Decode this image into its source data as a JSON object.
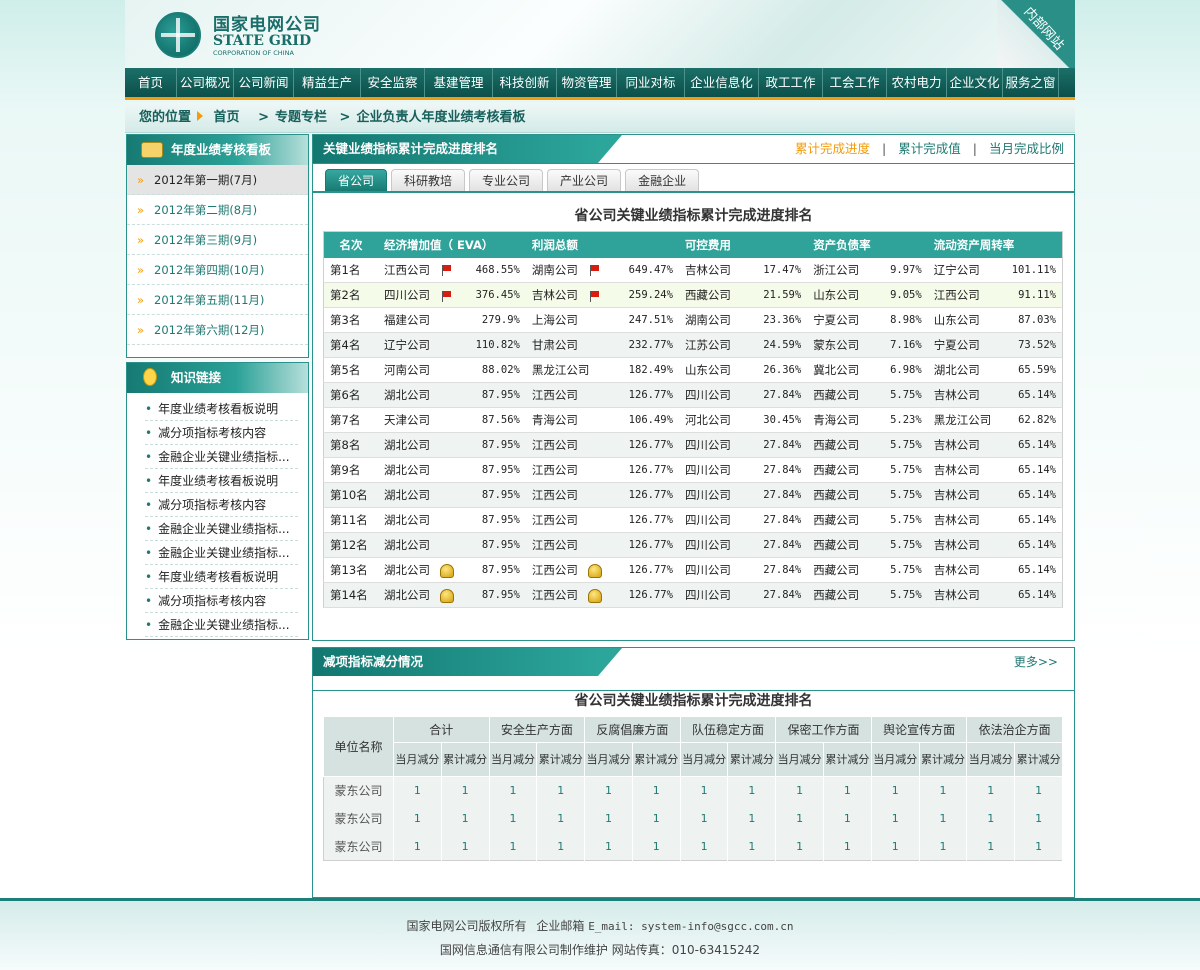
{
  "header": {
    "logo_cn": "国家电网公司",
    "logo_en": "STATE GRID",
    "logo_sub": "CORPORATION OF CHINA",
    "corner_badge": "内部网站"
  },
  "nav": [
    "首页",
    "公司概况",
    "公司新闻",
    "精益生产",
    "安全监察",
    "基建管理",
    "科技创新",
    "物资管理",
    "同业对标",
    "企业信息化",
    "政工工作",
    "工会工作",
    "农村电力",
    "企业文化",
    "服务之窗"
  ],
  "breadcrumb": {
    "label": "您的位置",
    "items": [
      "首页",
      "专题专栏",
      "企业负责人年度业绩考核看板"
    ]
  },
  "sidebar": {
    "periods_title": "年度业绩考核看板",
    "periods": [
      "2012年第一期(7月)",
      "2012年第二期(8月)",
      "2012年第三期(9月)",
      "2012年第四期(10月)",
      "2012年第五期(11月)",
      "2012年第六期(12月)"
    ],
    "links_title": "知识链接",
    "links": [
      "年度业绩考核看板说明",
      "减分项指标考核内容",
      "金融企业关键业绩指标...",
      "年度业绩考核看板说明",
      "减分项指标考核内容",
      "金融企业关键业绩指标...",
      "金融企业关键业绩指标...",
      "年度业绩考核看板说明",
      "减分项指标考核内容",
      "金融企业关键业绩指标..."
    ]
  },
  "ranking": {
    "panel_title": "关键业绩指标累计完成进度排名",
    "options": [
      "累计完成进度",
      "累计完成值",
      "当月完成比例"
    ],
    "tabs": [
      "省公司",
      "科研教培",
      "专业公司",
      "产业公司",
      "金融企业"
    ],
    "table_title": "省公司关键业绩指标累计完成进度排名",
    "columns": [
      "名次",
      "经济增加值（ EVA）",
      "利润总额",
      "可控费用",
      "资产负债率",
      "流动资产周转率"
    ],
    "rows": [
      {
        "rank": "第1名",
        "c1": "江西公司",
        "v1": "468.55%",
        "m1": "flag",
        "c2": "湖南公司",
        "v2": "649.47%",
        "m2": "flag",
        "c3": "吉林公司",
        "v3": "17.47%",
        "c4": "浙江公司",
        "v4": "9.97%",
        "c5": "辽宁公司",
        "v5": "101.11%"
      },
      {
        "rank": "第2名",
        "c1": "四川公司",
        "v1": "376.45%",
        "m1": "flag",
        "c2": "吉林公司",
        "v2": "259.24%",
        "m2": "flag",
        "c3": "西藏公司",
        "v3": "21.59%",
        "c4": "山东公司",
        "v4": "9.05%",
        "c5": "江西公司",
        "v5": "91.11%"
      },
      {
        "rank": "第3名",
        "c1": "福建公司",
        "v1": "279.9%",
        "m1": "",
        "c2": "上海公司",
        "v2": "247.51%",
        "m2": "",
        "c3": "湖南公司",
        "v3": "23.36%",
        "c4": "宁夏公司",
        "v4": "8.98%",
        "c5": "山东公司",
        "v5": "87.03%"
      },
      {
        "rank": "第4名",
        "c1": "辽宁公司",
        "v1": "110.82%",
        "m1": "",
        "c2": "甘肃公司",
        "v2": "232.77%",
        "m2": "",
        "c3": "江苏公司",
        "v3": "24.59%",
        "c4": "蒙东公司",
        "v4": "7.16%",
        "c5": "宁夏公司",
        "v5": "73.52%"
      },
      {
        "rank": "第5名",
        "c1": "河南公司",
        "v1": "88.02%",
        "m1": "",
        "c2": "黑龙江公司",
        "v2": "182.49%",
        "m2": "",
        "c3": "山东公司",
        "v3": "26.36%",
        "c4": "冀北公司",
        "v4": "6.98%",
        "c5": "湖北公司",
        "v5": "65.59%"
      },
      {
        "rank": "第6名",
        "c1": "湖北公司",
        "v1": "87.95%",
        "m1": "",
        "c2": "江西公司",
        "v2": "126.77%",
        "m2": "",
        "c3": "四川公司",
        "v3": "27.84%",
        "c4": "西藏公司",
        "v4": "5.75%",
        "c5": "吉林公司",
        "v5": "65.14%"
      },
      {
        "rank": "第7名",
        "c1": "天津公司",
        "v1": "87.56%",
        "m1": "",
        "c2": "青海公司",
        "v2": "106.49%",
        "m2": "",
        "c3": "河北公司",
        "v3": "30.45%",
        "c4": "青海公司",
        "v4": "5.23%",
        "c5": "黑龙江公司",
        "v5": "62.82%"
      },
      {
        "rank": "第8名",
        "c1": "湖北公司",
        "v1": "87.95%",
        "m1": "",
        "c2": "江西公司",
        "v2": "126.77%",
        "m2": "",
        "c3": "四川公司",
        "v3": "27.84%",
        "c4": "西藏公司",
        "v4": "5.75%",
        "c5": "吉林公司",
        "v5": "65.14%"
      },
      {
        "rank": "第9名",
        "c1": "湖北公司",
        "v1": "87.95%",
        "m1": "",
        "c2": "江西公司",
        "v2": "126.77%",
        "m2": "",
        "c3": "四川公司",
        "v3": "27.84%",
        "c4": "西藏公司",
        "v4": "5.75%",
        "c5": "吉林公司",
        "v5": "65.14%"
      },
      {
        "rank": "第10名",
        "c1": "湖北公司",
        "v1": "87.95%",
        "m1": "",
        "c2": "江西公司",
        "v2": "126.77%",
        "m2": "",
        "c3": "四川公司",
        "v3": "27.84%",
        "c4": "西藏公司",
        "v4": "5.75%",
        "c5": "吉林公司",
        "v5": "65.14%"
      },
      {
        "rank": "第11名",
        "c1": "湖北公司",
        "v1": "87.95%",
        "m1": "",
        "c2": "江西公司",
        "v2": "126.77%",
        "m2": "",
        "c3": "四川公司",
        "v3": "27.84%",
        "c4": "西藏公司",
        "v4": "5.75%",
        "c5": "吉林公司",
        "v5": "65.14%"
      },
      {
        "rank": "第12名",
        "c1": "湖北公司",
        "v1": "87.95%",
        "m1": "",
        "c2": "江西公司",
        "v2": "126.77%",
        "m2": "",
        "c3": "四川公司",
        "v3": "27.84%",
        "c4": "西藏公司",
        "v4": "5.75%",
        "c5": "吉林公司",
        "v5": "65.14%"
      },
      {
        "rank": "第13名",
        "c1": "湖北公司",
        "v1": "87.95%",
        "m1": "bell",
        "c2": "江西公司",
        "v2": "126.77%",
        "m2": "bell",
        "c3": "四川公司",
        "v3": "27.84%",
        "c4": "西藏公司",
        "v4": "5.75%",
        "c5": "吉林公司",
        "v5": "65.14%"
      },
      {
        "rank": "第14名",
        "c1": "湖北公司",
        "v1": "87.95%",
        "m1": "bell",
        "c2": "江西公司",
        "v2": "126.77%",
        "m2": "bell",
        "c3": "四川公司",
        "v3": "27.84%",
        "c4": "西藏公司",
        "v4": "5.75%",
        "c5": "吉林公司",
        "v5": "65.14%"
      }
    ]
  },
  "deduction": {
    "panel_title": "减项指标减分情况",
    "more": "更多>>",
    "table_title": "省公司关键业绩指标累计完成进度排名",
    "unit_header": "单位名称",
    "groups": [
      "合计",
      "安全生产方面",
      "反腐倡廉方面",
      "队伍稳定方面",
      "保密工作方面",
      "舆论宣传方面",
      "依法治企方面"
    ],
    "sub_headers": [
      "当月减分",
      "累计减分"
    ],
    "rows": [
      {
        "name": "蒙东公司",
        "values": [
          "1",
          "1",
          "1",
          "1",
          "1",
          "1",
          "1",
          "1",
          "1",
          "1",
          "1",
          "1",
          "1",
          "1"
        ]
      },
      {
        "name": "蒙东公司",
        "values": [
          "1",
          "1",
          "1",
          "1",
          "1",
          "1",
          "1",
          "1",
          "1",
          "1",
          "1",
          "1",
          "1",
          "1"
        ]
      },
      {
        "name": "蒙东公司",
        "values": [
          "1",
          "1",
          "1",
          "1",
          "1",
          "1",
          "1",
          "1",
          "1",
          "1",
          "1",
          "1",
          "1",
          "1"
        ]
      }
    ]
  },
  "footer": {
    "line1_a": "国家电网公司版权所有",
    "line1_link": "企业邮箱",
    "line1_b": "E_mail: system-info@sgcc.com.cn",
    "line2": "国网信息通信有限公司制作维护 网站传真：010-63415242"
  }
}
